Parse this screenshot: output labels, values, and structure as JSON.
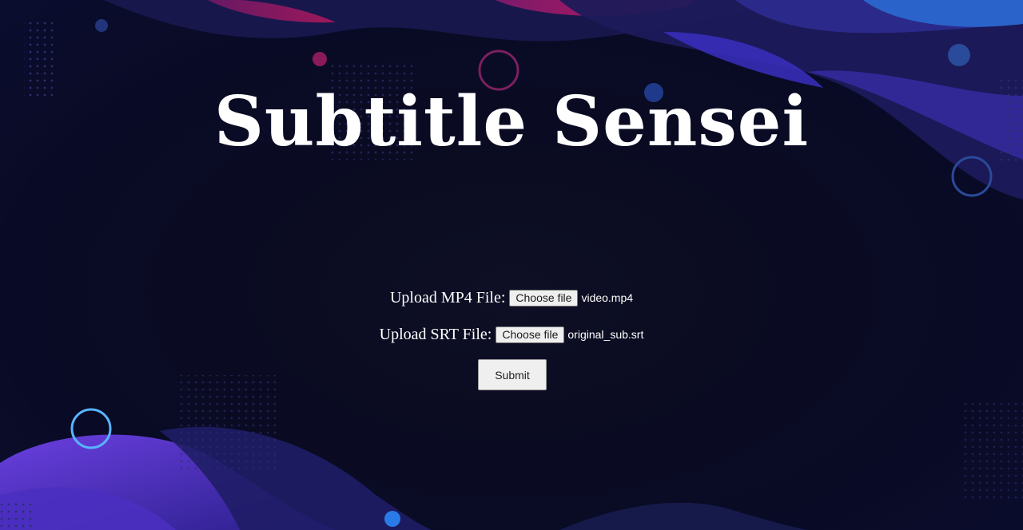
{
  "app": {
    "title": "Subtitle Sensei"
  },
  "form": {
    "mp4": {
      "label": "Upload MP4 File:",
      "button_label": "Choose file",
      "file_name": "video.mp4"
    },
    "srt": {
      "label": "Upload SRT File:",
      "button_label": "Choose file",
      "file_name": "original_sub.srt"
    },
    "submit_label": "Submit"
  },
  "theme": {
    "background": "#080a22",
    "accent_purple": "#5b3bd6",
    "accent_magenta": "#c0185f",
    "accent_blue": "#2a6fd6"
  }
}
